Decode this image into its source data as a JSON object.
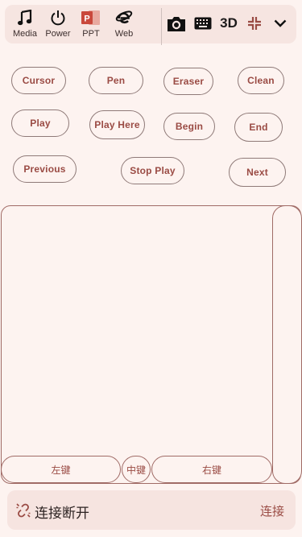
{
  "toolbar": {
    "left_items": [
      {
        "label": "Media",
        "icon": "music-note-icon"
      },
      {
        "label": "Power",
        "icon": "power-icon"
      },
      {
        "label": "PPT",
        "icon": "powerpoint-icon"
      },
      {
        "label": "Web",
        "icon": "internet-explorer-icon"
      }
    ],
    "right_items": {
      "camera_icon": "camera-icon",
      "keyboard_icon": "keyboard-icon",
      "three_d_label": "3D",
      "collapse_icon": "collapse-icon",
      "more_icon": "chevron-down-icon"
    },
    "ppt_icon_letter": "P",
    "ppt_color": "#c9483b"
  },
  "controls": {
    "cursor": "Cursor",
    "pen": "Pen",
    "eraser": "Eraser",
    "clean": "Clean",
    "play": "Play",
    "play_here": "Play Here",
    "begin": "Begin",
    "end": "End",
    "previous": "Previous",
    "stop_play": "Stop Play",
    "next": "Next"
  },
  "touchpad": {
    "left_button": "左键",
    "middle_button": "中键",
    "right_button": "右键"
  },
  "status": {
    "icon": "link-off-icon",
    "text": "连接断开",
    "connect_label": "连接"
  },
  "colors": {
    "background": "#fdf3f0",
    "accent": "#9a4b44",
    "panel": "#f6e5e1"
  }
}
